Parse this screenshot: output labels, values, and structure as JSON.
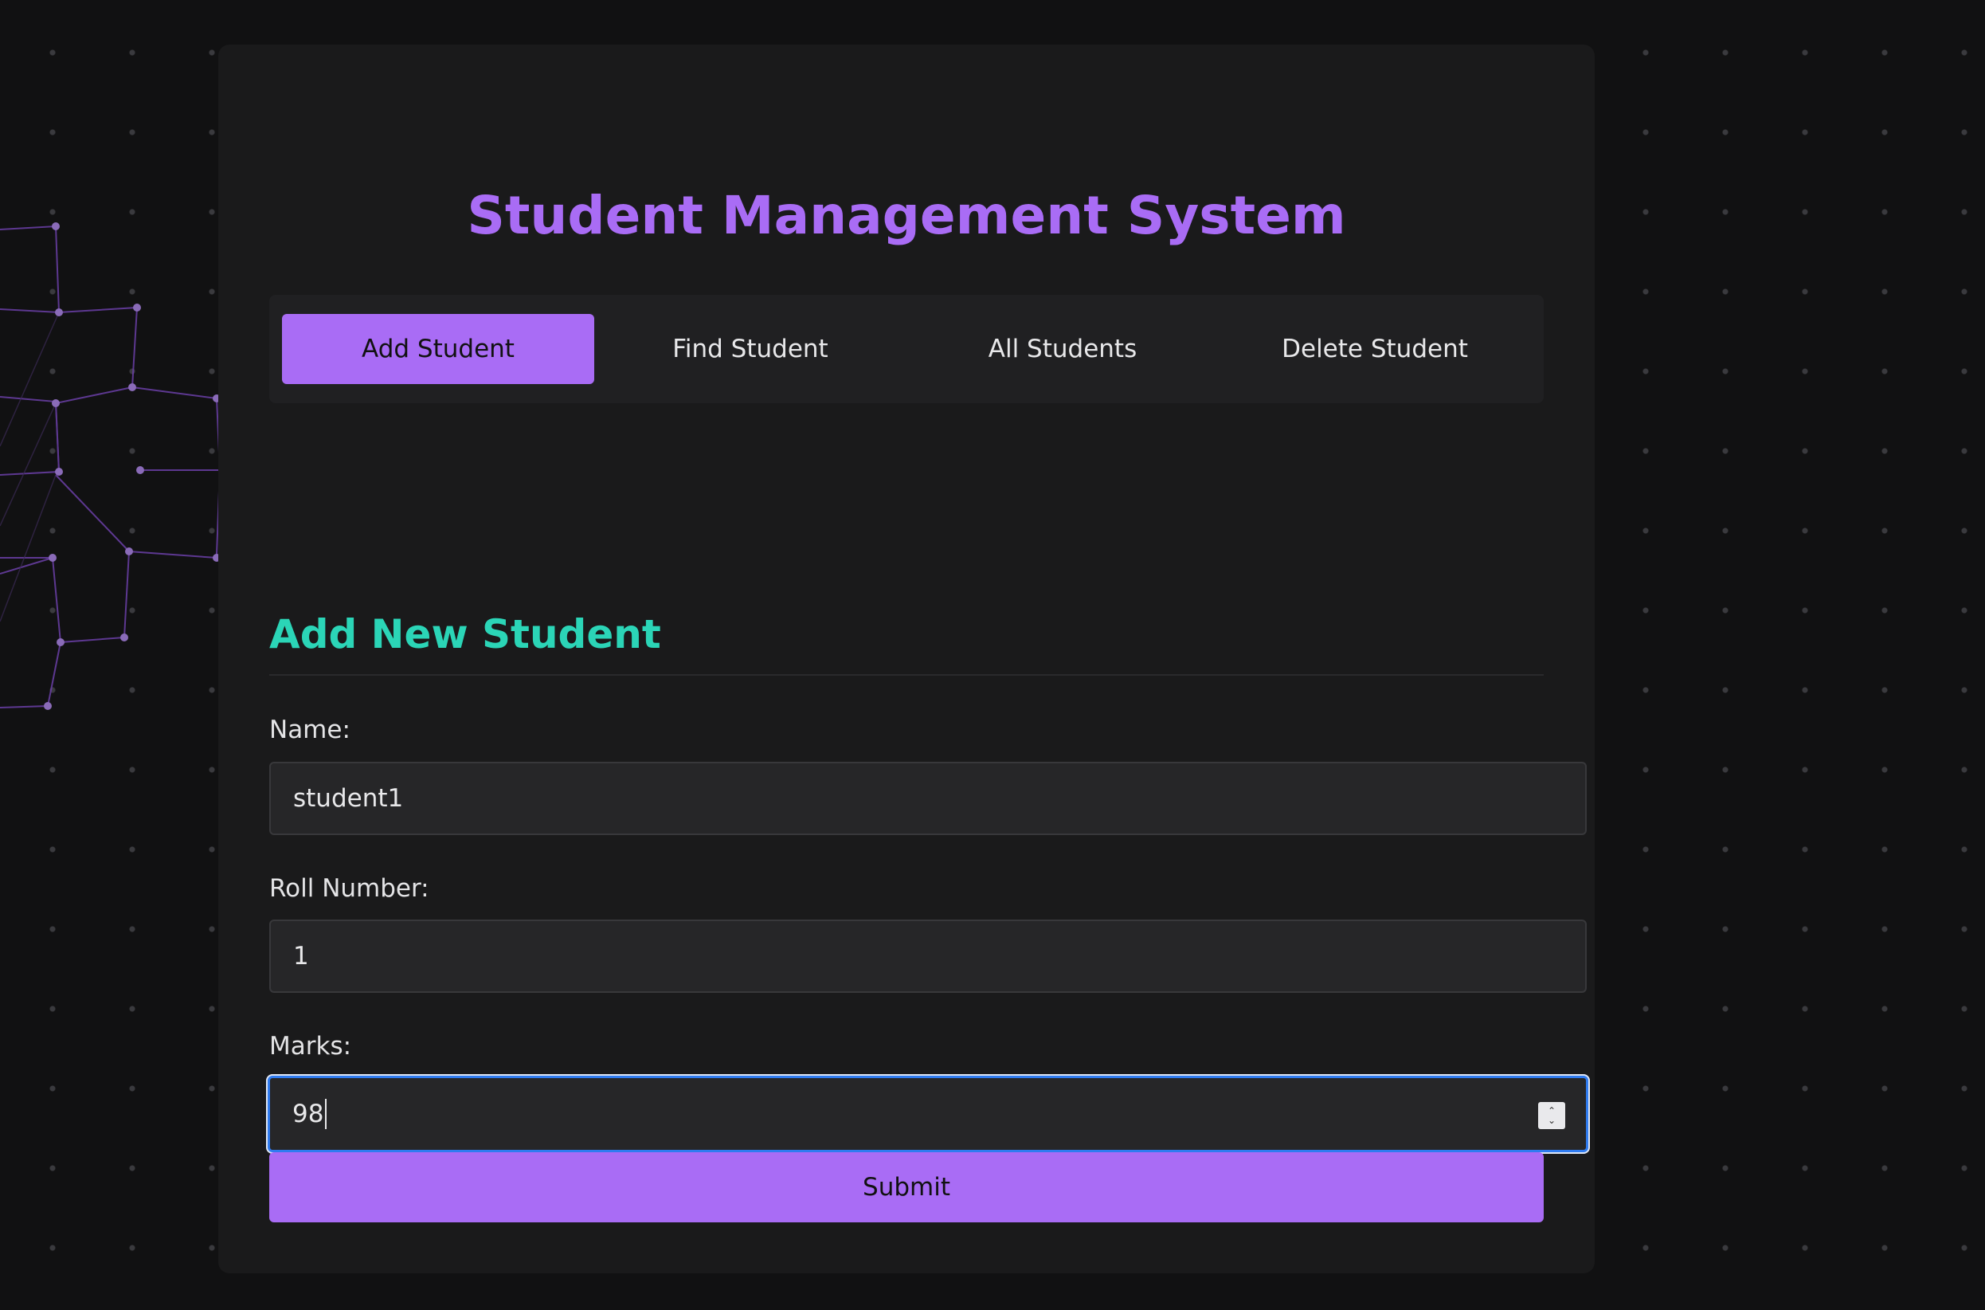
{
  "header": {
    "title": "Student Management System"
  },
  "tabs": [
    {
      "label": "Add Student",
      "active": true
    },
    {
      "label": "Find Student",
      "active": false
    },
    {
      "label": "All Students",
      "active": false
    },
    {
      "label": "Delete Student",
      "active": false
    }
  ],
  "form": {
    "section_title": "Add New Student",
    "name": {
      "label": "Name:",
      "value": "student1"
    },
    "roll_number": {
      "label": "Roll Number:",
      "value": "1"
    },
    "marks": {
      "label": "Marks:",
      "value": "98"
    },
    "submit_label": "Submit"
  },
  "colors": {
    "accent": "#a96cf5",
    "section_title": "#2bd5b7",
    "focus_ring": "#2f7bf0",
    "background": "#111112",
    "card": "#1a1a1b"
  },
  "icons": {
    "stepper": "number-stepper-icon"
  }
}
